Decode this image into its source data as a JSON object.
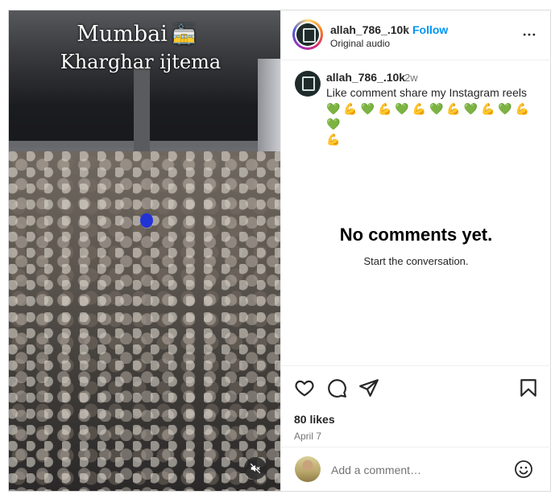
{
  "media": {
    "title_line1": "Mumbai",
    "title_line2": "Kharghar ijtema",
    "title_icon": "🚋"
  },
  "header": {
    "username": "allah_786_.10k",
    "separator": "•",
    "follow_label": "Follow",
    "audio_label": "Original audio",
    "more_label": "•••"
  },
  "caption": {
    "username": "allah_786_.10k",
    "time": "2w",
    "text": "Like comment share my Instagram reels",
    "emojis_line1": [
      "💚",
      "💪",
      "💚",
      "💪",
      "💚",
      "💪",
      "💚",
      "💪",
      "💚",
      "💪",
      "💚",
      "💪",
      "💚"
    ],
    "emojis_line2": [
      "💪"
    ]
  },
  "empty_state": {
    "title": "No comments yet.",
    "subtitle": "Start the conversation."
  },
  "engagement": {
    "likes": "80 likes",
    "date": "April 7"
  },
  "comment": {
    "placeholder": "Add a comment…"
  },
  "colors": {
    "follow": "#0095f6",
    "heart": "#24c15a",
    "muted_text": "#737373"
  },
  "icons": [
    "train-icon",
    "more-icon",
    "mute-icon",
    "like-icon",
    "comment-icon",
    "share-icon",
    "save-icon",
    "emoji-icon"
  ]
}
